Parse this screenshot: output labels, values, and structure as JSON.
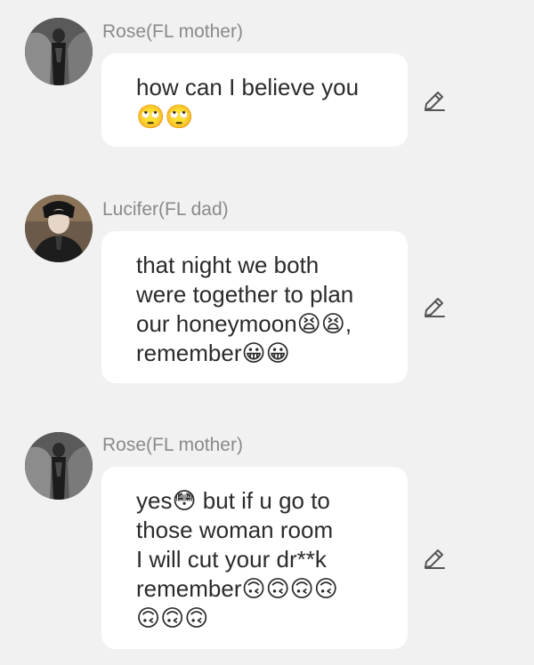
{
  "messages": [
    {
      "sender": "Rose(FL mother)",
      "text": "how can I believe you\n🙄🙄",
      "avatar_icon": "woman-portrait-icon"
    },
    {
      "sender": "Lucifer(FL dad)",
      "text": "that night we both\nwere together to plan\nour honeymoon😫😫,\nremember😀😀",
      "avatar_icon": "man-portrait-icon"
    },
    {
      "sender": "Rose(FL mother)",
      "text": "yes😳 but if u go to\nthose woman room\nI will cut your dr**k\nremember🙃🙃🙃🙃\n🙃🙃🙃",
      "avatar_icon": "woman-portrait-icon"
    }
  ],
  "edit_icon": "pencil-icon",
  "colors": {
    "background": "#f1f1f1",
    "bubble": "#ffffff",
    "name": "#8a8a8a",
    "text": "#2b2b2b"
  }
}
